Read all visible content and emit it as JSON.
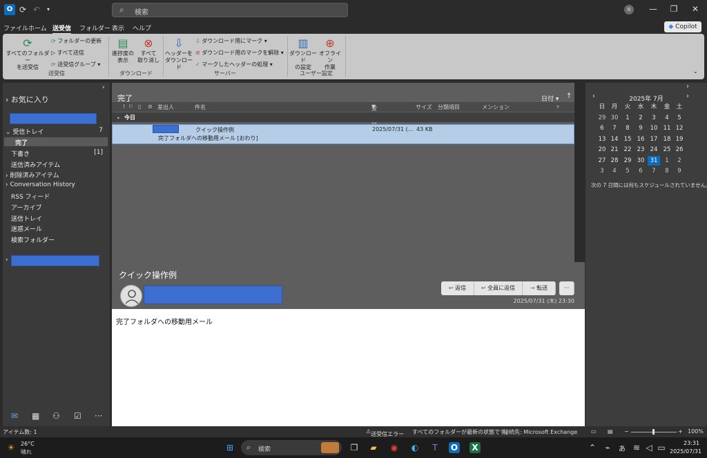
{
  "titlebar": {
    "search_placeholder": "検索",
    "user_initial": "B"
  },
  "menubar": {
    "items": [
      "ファイル",
      "ホーム",
      "送受信",
      "フォルダー",
      "表示",
      "ヘルプ"
    ],
    "active": "送受信",
    "copilot_label": "Copilot"
  },
  "ribbon": {
    "send_receive_all": "すべてのフォルダー\nを送受信",
    "update_folder": "フォルダーの更新",
    "send_all": "すべて送信",
    "send_receive_groups": "送受信グループ",
    "group_send_receive": "送受信",
    "show_progress": "進捗度の\n表示",
    "cancel_all": "すべて\n取り消し",
    "group_download": "ダウンロード",
    "download_headers": "ヘッダーを\nダウンロード",
    "mark_download": "ダウンロード用にマーク",
    "unmark_download": "ダウンロード用のマークを解除",
    "process_marked": "マークしたヘッダーの処理",
    "group_server": "サーバー",
    "download_settings": "ダウンロード\nの設定",
    "offline_work": "オフライン\n作業",
    "group_user_settings": "ユーザー設定"
  },
  "nav": {
    "favorites": "お気に入り",
    "inbox": "受信トレイ",
    "inbox_count": "7",
    "done": "完了",
    "drafts": "下書き",
    "drafts_count": "[1]",
    "sent": "送信済みアイテム",
    "deleted": "削除済みアイテム",
    "conversation_history": "Conversation History",
    "rss": "RSS フィード",
    "archive": "アーカイブ",
    "outbox": "送信トレイ",
    "junk": "迷惑メール",
    "search_folders": "検索フォルダー"
  },
  "list": {
    "title": "完了",
    "sort_label": "日付",
    "columns": {
      "from": "差出人",
      "subject": "件名",
      "received": "受信日時",
      "size": "サイズ",
      "category": "分類項目",
      "mention": "メンション"
    },
    "group_today": "今日",
    "message": {
      "subject": "クイック操作例",
      "preview": "完了フォルダへの移動用メール [おわり]",
      "received": "2025/07/31 (...",
      "size": "43 KB"
    }
  },
  "reading": {
    "subject": "クイック操作例",
    "reply": "返信",
    "reply_all": "全員に返信",
    "forward": "転送",
    "more": "···",
    "date": "2025/07/31 (木) 23:30",
    "body": "完了フォルダへの移動用メール"
  },
  "calendar": {
    "title": "2025年 7月",
    "weekdays": [
      "日",
      "月",
      "火",
      "水",
      "木",
      "金",
      "土"
    ],
    "weeks": [
      [
        "29",
        "30",
        "1",
        "2",
        "3",
        "4",
        "5"
      ],
      [
        "6",
        "7",
        "8",
        "9",
        "10",
        "11",
        "12"
      ],
      [
        "13",
        "14",
        "15",
        "16",
        "17",
        "18",
        "19"
      ],
      [
        "20",
        "21",
        "22",
        "23",
        "24",
        "25",
        "26"
      ],
      [
        "27",
        "28",
        "29",
        "30",
        "31",
        "1",
        "2"
      ],
      [
        "3",
        "4",
        "5",
        "6",
        "7",
        "8",
        "9"
      ]
    ],
    "today": "31",
    "no_schedule": "次の 7 日間には何もスケジュールされていません。"
  },
  "status": {
    "item_count": "アイテム数: 1",
    "error": "送受信エラー",
    "folders_updated": "すべてのフォルダーが最新の状態です。",
    "connection": "接続先: Microsoft Exchange",
    "zoom": "100%"
  },
  "taskbar": {
    "weather_temp": "26°C",
    "weather_desc": "晴れ",
    "search": "検索",
    "ime": "あ",
    "time": "23:31",
    "date": "2025/07/31"
  }
}
